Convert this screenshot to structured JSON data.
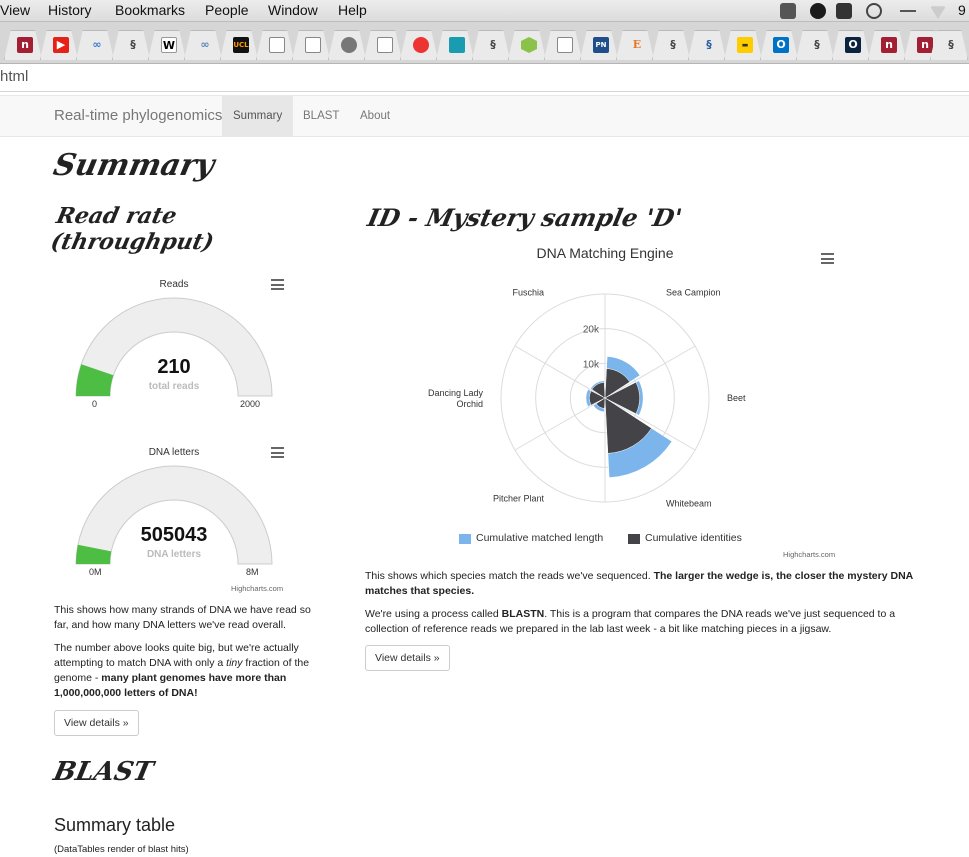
{
  "browser": {
    "menu": [
      "View",
      "History",
      "Bookmarks",
      "People",
      "Window",
      "Help"
    ],
    "address": "html",
    "tray_clock": "9"
  },
  "navbar": {
    "brand": "Real-time phylogenomics",
    "links": [
      "Summary",
      "BLAST",
      "About"
    ],
    "active": "Summary"
  },
  "page": {
    "title": "Summary",
    "read_rate_heading": "Read rate (throughput)",
    "id_heading": "ID - Mystery sample 'D'",
    "blast_heading": "BLAST",
    "summary_table_heading": "Summary table",
    "summary_table_note": "(DataTables render of blast hits)"
  },
  "gauge_reads": {
    "title": "Reads",
    "value": "210",
    "unit": "total reads",
    "min": "0",
    "max": "2000",
    "fraction": 0.105
  },
  "gauge_letters": {
    "title": "DNA letters",
    "value": "505043",
    "unit": "DNA letters",
    "min": "0M",
    "max": "8M",
    "fraction": 0.063
  },
  "credits": "Highcharts.com",
  "left_text": {
    "p1": "This shows how many strands of DNA we have read so far, and how many DNA letters we've read overall.",
    "p2_a": "The number above looks quite big, but we're actually attempting to match DNA with only a ",
    "p2_em": "tiny",
    "p2_b": " fraction of the genome - ",
    "p2_strong": "many plant genomes have more than 1,000,000,000 letters of DNA!",
    "button": "View details »"
  },
  "right_text": {
    "p1_a": "This shows which species match the reads we've sequenced. ",
    "p1_strong": "The larger the wedge is, the closer the mystery DNA matches that species.",
    "p2_a": "We're using a process called ",
    "p2_strong": "BLASTN",
    "p2_b": ". This is a program that compares the DNA reads we've just sequenced to a collection of reference reads we prepared in the lab last week - a bit like matching pieces in a jigsaw.",
    "button": "View details »"
  },
  "chart_data": {
    "type": "polar-column",
    "title": "DNA Matching Engine",
    "categories": [
      "Sea Campion",
      "Beet",
      "Whitebeam",
      "Pitcher Plant",
      "Dancing Lady Orchid",
      "Fuschia"
    ],
    "y_ticks": [
      "10k",
      "20k"
    ],
    "ymax": 30000,
    "series": [
      {
        "name": "Cumulative matched length",
        "color": "#7cb5ec",
        "values": [
          12000,
          11000,
          23000,
          4000,
          5500,
          5000
        ]
      },
      {
        "name": "Cumulative identities",
        "color": "#434348",
        "values": [
          8500,
          10000,
          16000,
          3000,
          4500,
          4500
        ]
      }
    ],
    "legend": "bottom"
  }
}
